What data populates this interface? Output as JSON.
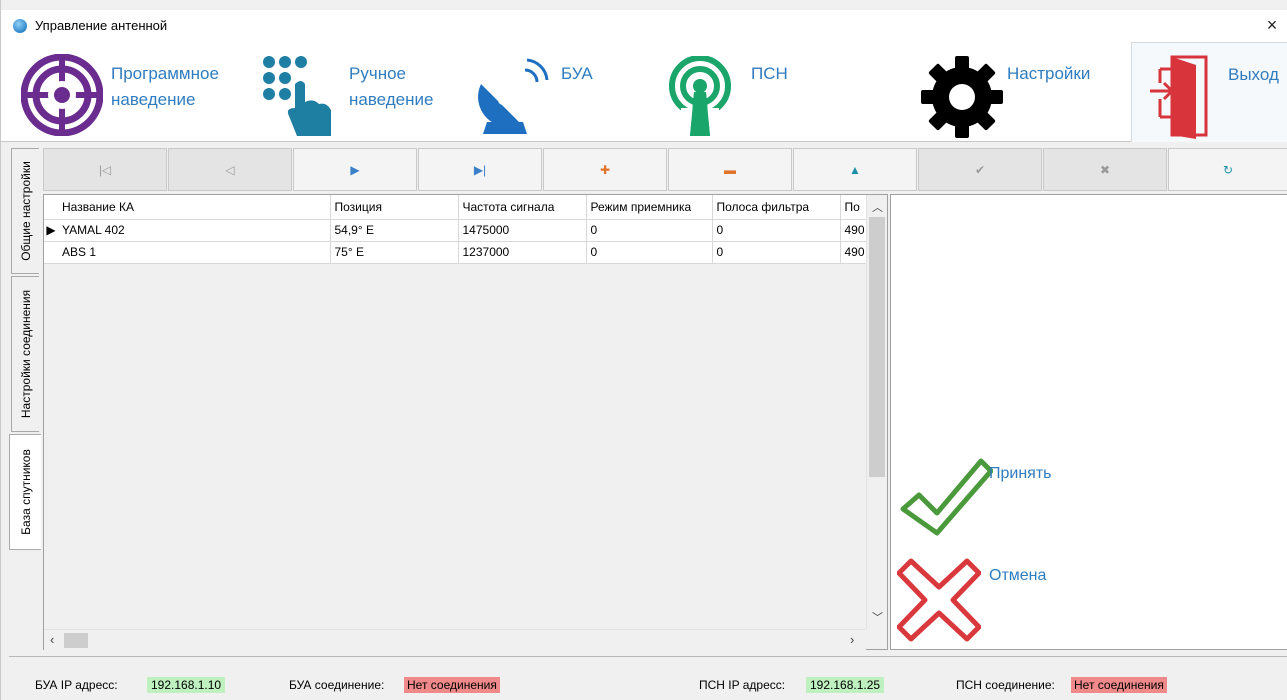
{
  "window": {
    "title": "Управление антенной",
    "close": "×"
  },
  "ribbon": {
    "program_line1": "Программное",
    "program_line2": "наведение",
    "manual_line1": "Ручное",
    "manual_line2": "наведение",
    "bua": "БУА",
    "psn": "ПСН",
    "settings": "Настройки",
    "exit": "Выход"
  },
  "side_tabs": [
    "Общие настройки",
    "Настройки соединения",
    "База спутников"
  ],
  "navigator": {
    "first": "|◁",
    "prev": "◁",
    "next": "▶",
    "last": "▶|",
    "add": "✚",
    "delete": "▬",
    "up": "▲",
    "post": "✔",
    "cancel": "✖",
    "refresh": "↻"
  },
  "grid": {
    "columns": [
      "Название КА",
      "Позиция",
      "Частота сигнала",
      "Режим приемника",
      "Полоса фильтра",
      "По"
    ],
    "rows": [
      {
        "indicator": "▶",
        "cells": [
          "YAMAL 402",
          "54,9° E",
          "1475000",
          "0",
          "0",
          "490"
        ]
      },
      {
        "indicator": "",
        "cells": [
          "ABS 1",
          "75° E",
          "1237000",
          "0",
          "0",
          "490"
        ]
      }
    ]
  },
  "actions": {
    "accept": "Принять",
    "cancel": "Отмена"
  },
  "status": {
    "bua_ip_label": "БУА IP адресс:",
    "bua_ip": "192.168.1.10",
    "bua_conn_label": "БУА соединение:",
    "bua_conn": "Нет соединения",
    "psn_ip_label": "ПСН IP адресс:",
    "psn_ip": "192.168.1.25",
    "psn_conn_label": "ПСН соединение:",
    "psn_conn": "Нет соединения"
  },
  "colors": {
    "accent_blue": "#2f7cbf",
    "purple": "#6a2c8e",
    "teal": "#1f7fa3",
    "green": "#1aa56a",
    "accept_green": "#4a9a3c",
    "cancel_red": "#d9383c",
    "exit_red": "#d8343c",
    "ok_bg": "#bff0bf",
    "err_bg": "#f08a8a"
  }
}
